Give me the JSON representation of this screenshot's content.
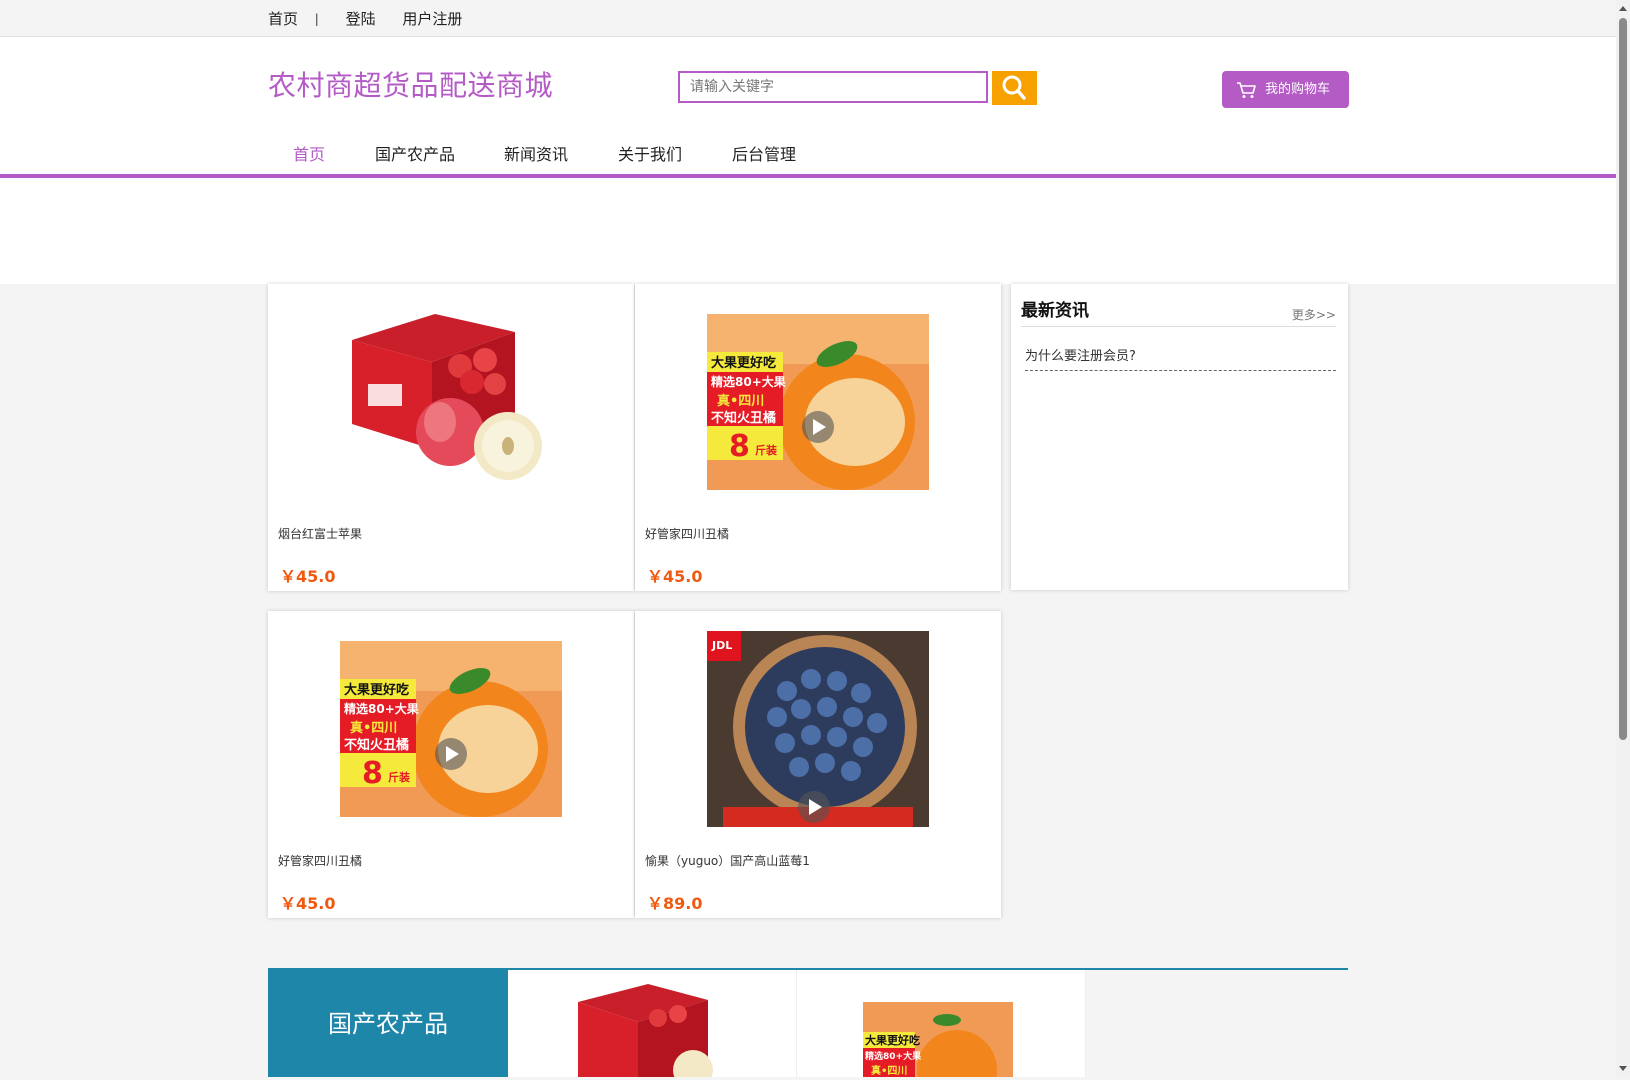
{
  "topbar": {
    "home": "首页",
    "separator": "|",
    "login": "登陆",
    "register": "用户注册"
  },
  "header": {
    "site_title": "农村商超货品配送商城",
    "search_placeholder": "请输入关键字",
    "search_icon": "search-icon",
    "cart_label": "我的购物车",
    "cart_icon": "cart-icon"
  },
  "nav": {
    "items": [
      {
        "label": "首页",
        "active": true
      },
      {
        "label": "国产农产品",
        "active": false
      },
      {
        "label": "新闻资讯",
        "active": false
      },
      {
        "label": "关于我们",
        "active": false
      },
      {
        "label": "后台管理",
        "active": false
      }
    ]
  },
  "products": [
    {
      "name": "烟台红富士苹果",
      "price": "￥45.0",
      "image": "apple-box"
    },
    {
      "name": "好管家四川丑橘",
      "price": "￥45.0",
      "image": "orange-box"
    },
    {
      "name": "好管家四川丑橘",
      "price": "￥45.0",
      "image": "orange-box"
    },
    {
      "name": "愉果（yuguo）国产高山蓝莓1",
      "price": "￥89.0",
      "image": "blueberry-bowl"
    }
  ],
  "news": {
    "title": "最新资讯",
    "more": "更多>>",
    "items": [
      "为什么要注册会员?"
    ]
  },
  "section": {
    "title": "国产农产品"
  },
  "colors": {
    "brand": "#b45bc6",
    "search_button": "#f6a100",
    "price": "#f05a10",
    "section_head": "#1e86a8"
  }
}
